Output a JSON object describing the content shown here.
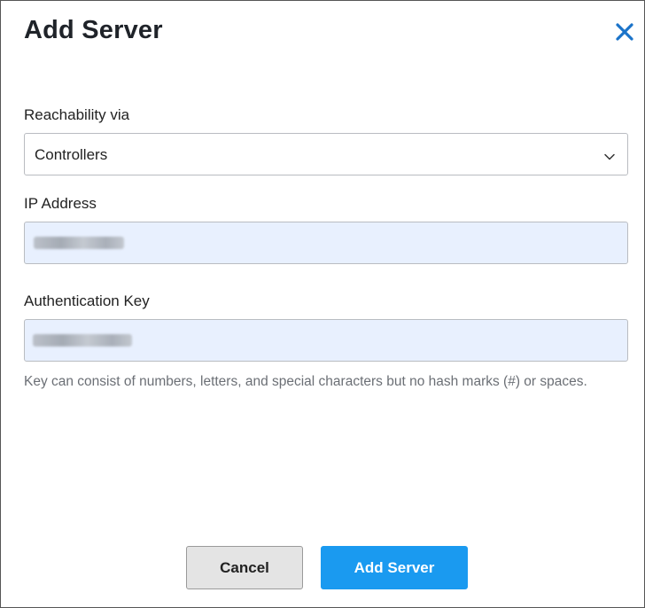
{
  "dialog": {
    "title": "Add Server",
    "close_icon": "close-icon"
  },
  "reachability": {
    "label": "Reachability via",
    "selected": "Controllers",
    "icon": "chevron-down-icon"
  },
  "ip_address": {
    "label": "IP Address",
    "value": ""
  },
  "auth_key": {
    "label": "Authentication Key",
    "value": "",
    "hint": "Key can consist of numbers, letters, and special characters but no hash marks (#) or spaces."
  },
  "buttons": {
    "cancel": "Cancel",
    "add": "Add Server"
  },
  "colors": {
    "accent": "#1a9af0",
    "close": "#1a73c9",
    "autofill_bg": "#e8f0fe"
  }
}
